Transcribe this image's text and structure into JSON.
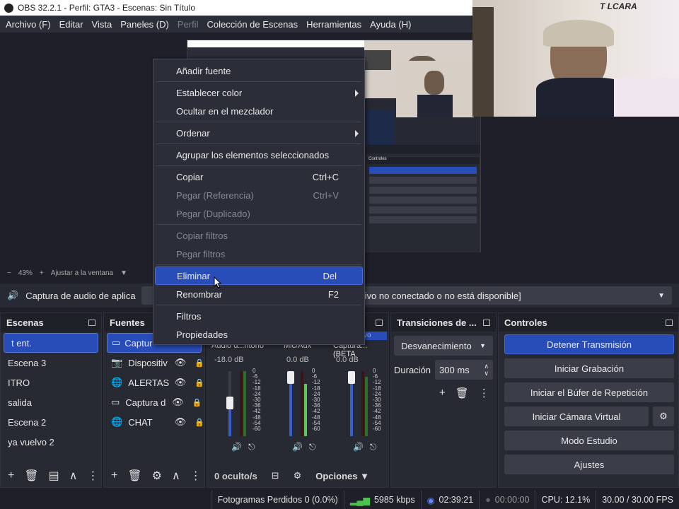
{
  "window": {
    "title": "OBS 32.2.1 - Perfil: GTA3 - Escenas: Sin Título"
  },
  "menubar": {
    "items": [
      "Archivo (F)",
      "Editar",
      "Vista",
      "Paneles (D)",
      "Perfil",
      "Colección de Escenas",
      "Herramientas",
      "Ayuda (H)"
    ]
  },
  "webcam": {
    "caption": "T LCARA"
  },
  "preview_controls": {
    "zoom": "43%",
    "fit_label": "Ajustar a la ventana"
  },
  "infobar": {
    "source_name": "Captura de audio de aplica",
    "status_message": "tivo no conectado o no está disponible]"
  },
  "context_menu": {
    "items": [
      {
        "label": "Añadir fuente",
        "shortcut": ""
      },
      {
        "label": "Establecer color",
        "shortcut": ""
      },
      {
        "label": "Ocultar en el mezclador",
        "shortcut": ""
      },
      {
        "label": "Ordenar",
        "shortcut": ""
      },
      {
        "label": "Agrupar los elementos seleccionados",
        "shortcut": ""
      },
      {
        "label": "Copiar",
        "shortcut": "Ctrl+C"
      },
      {
        "label": "Pegar (Referencia)",
        "shortcut": "Ctrl+V"
      },
      {
        "label": "Pegar (Duplicado)",
        "shortcut": ""
      },
      {
        "label": "Copiar filtros",
        "shortcut": ""
      },
      {
        "label": "Pegar filtros",
        "shortcut": ""
      },
      {
        "label": "Eliminar",
        "shortcut": "Del"
      },
      {
        "label": "Renombrar",
        "shortcut": "F2"
      },
      {
        "label": "Filtros",
        "shortcut": ""
      },
      {
        "label": "Propiedades",
        "shortcut": ""
      }
    ]
  },
  "scenes": {
    "title": "Escenas",
    "items": [
      "t ent.",
      "Escena 3",
      "ITRO",
      "salida",
      "Escena 2",
      "ya vuelvo 2"
    ]
  },
  "sources": {
    "title": "Fuentes",
    "items": [
      "Captur",
      "Dispositiv",
      "ALERTAS D",
      "Captura d",
      "CHAT"
    ]
  },
  "mixer": {
    "badge": "tivo",
    "channels": [
      {
        "name": "Audio d...ritorio",
        "db": "-18.0 dB"
      },
      {
        "name": "Mic/Aux",
        "db": "0.0 dB"
      },
      {
        "name": "Captura... (BETA",
        "db": "0.0 dB"
      }
    ],
    "ticks": [
      "0",
      "-6",
      "-12",
      "-18",
      "-24",
      "-30",
      "-36",
      "-42",
      "-48",
      "-54",
      "-60"
    ],
    "hidden_label": "0 oculto/s",
    "options_label": "Opciones"
  },
  "transitions": {
    "title": "Transiciones de ...",
    "selected": "Desvanecimiento",
    "duration_label": "Duración",
    "duration_value": "300 ms"
  },
  "controls": {
    "title": "Controles",
    "buttons": [
      "Detener Transmisión",
      "Iniciar Grabación",
      "Iniciar el Búfer de Repetición",
      "Iniciar Cámara Virtual",
      "Modo Estudio",
      "Ajustes"
    ]
  },
  "status": {
    "dropped_frames": "Fotogramas Perdidos 0 (0.0%)",
    "bitrate": "5985 kbps",
    "stream_time": "02:39:21",
    "record_time": "00:00:00",
    "cpu": "CPU: 12.1%",
    "fps": "30.00 / 30.00 FPS"
  },
  "colors": {
    "accent": "#284cb8",
    "panel": "#272a33",
    "bg": "#1e1f29"
  }
}
